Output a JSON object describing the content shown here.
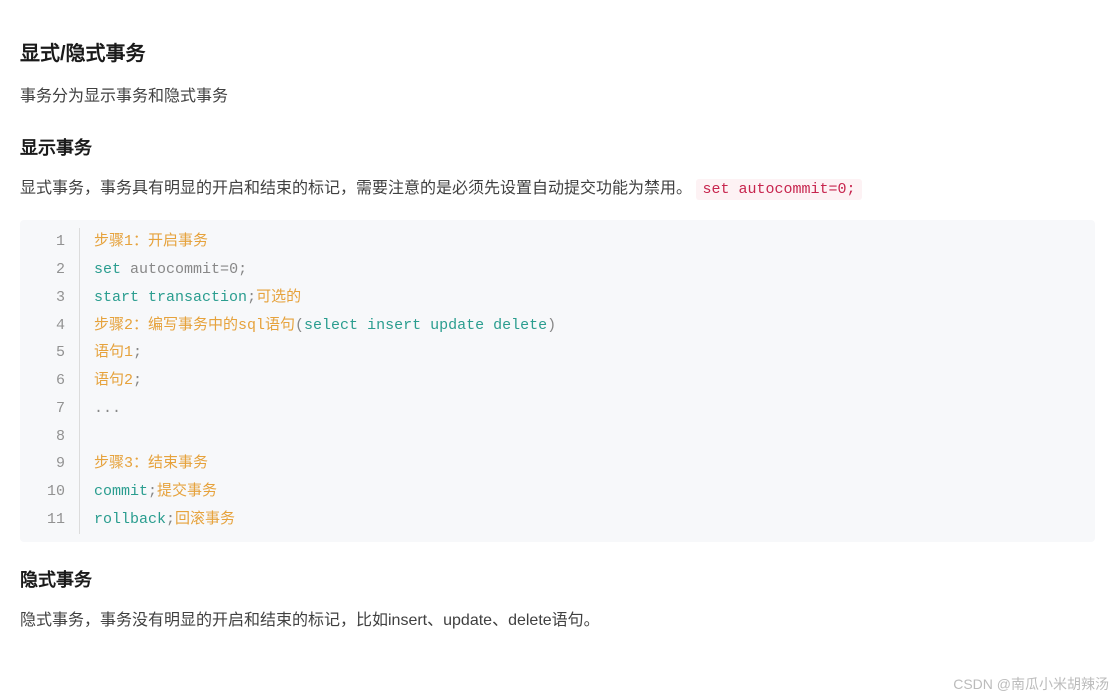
{
  "headings": {
    "h2_main": "显式/隐式事务",
    "h3_explicit": "显示事务",
    "h3_implicit": "隐式事务"
  },
  "paragraphs": {
    "p_intro": "事务分为显示事务和隐式事务",
    "p_explicit_desc_prefix": "显式事务，事务具有明显的开启和结束的标记，需要注意的是必须先设置自动提交功能为禁用。",
    "p_explicit_inline_code": "set autocommit=0;",
    "p_implicit_desc": "隐式事务，事务没有明显的开启和结束的标记，比如insert、update、delete语句。"
  },
  "code": {
    "lines": [
      {
        "n": "1",
        "tokens": [
          {
            "t": "步骤1：开启事务",
            "c": "orange"
          }
        ]
      },
      {
        "n": "2",
        "tokens": [
          {
            "t": "set",
            "c": "teal"
          },
          {
            "t": " autocommit",
            "c": "grey"
          },
          {
            "t": "=",
            "c": "grey"
          },
          {
            "t": "0",
            "c": "grey"
          },
          {
            "t": ";",
            "c": "grey"
          }
        ]
      },
      {
        "n": "3",
        "tokens": [
          {
            "t": "start",
            "c": "teal"
          },
          {
            "t": " ",
            "c": "grey"
          },
          {
            "t": "transaction",
            "c": "teal"
          },
          {
            "t": ";",
            "c": "grey"
          },
          {
            "t": "可选的",
            "c": "orange"
          }
        ]
      },
      {
        "n": "4",
        "tokens": [
          {
            "t": "步骤2：编写事务中的sql语句",
            "c": "orange"
          },
          {
            "t": "(",
            "c": "grey"
          },
          {
            "t": "select",
            "c": "teal"
          },
          {
            "t": " ",
            "c": "grey"
          },
          {
            "t": "insert",
            "c": "teal"
          },
          {
            "t": " ",
            "c": "grey"
          },
          {
            "t": "update",
            "c": "teal"
          },
          {
            "t": " ",
            "c": "grey"
          },
          {
            "t": "delete",
            "c": "teal"
          },
          {
            "t": ")",
            "c": "grey"
          }
        ]
      },
      {
        "n": "5",
        "tokens": [
          {
            "t": "语句1",
            "c": "orange"
          },
          {
            "t": ";",
            "c": "grey"
          }
        ]
      },
      {
        "n": "6",
        "tokens": [
          {
            "t": "语句2",
            "c": "orange"
          },
          {
            "t": ";",
            "c": "grey"
          }
        ]
      },
      {
        "n": "7",
        "tokens": [
          {
            "t": "...",
            "c": "grey"
          }
        ]
      },
      {
        "n": "8",
        "tokens": [
          {
            "t": "",
            "c": "grey"
          }
        ]
      },
      {
        "n": "9",
        "tokens": [
          {
            "t": "步骤3：结束事务",
            "c": "orange"
          }
        ]
      },
      {
        "n": "10",
        "tokens": [
          {
            "t": "commit",
            "c": "teal"
          },
          {
            "t": ";",
            "c": "grey"
          },
          {
            "t": "提交事务",
            "c": "orange"
          }
        ]
      },
      {
        "n": "11",
        "tokens": [
          {
            "t": "rollback",
            "c": "teal"
          },
          {
            "t": ";",
            "c": "grey"
          },
          {
            "t": "回滚事务",
            "c": "orange"
          }
        ]
      }
    ]
  },
  "watermark": "CSDN @南瓜小米胡辣汤"
}
